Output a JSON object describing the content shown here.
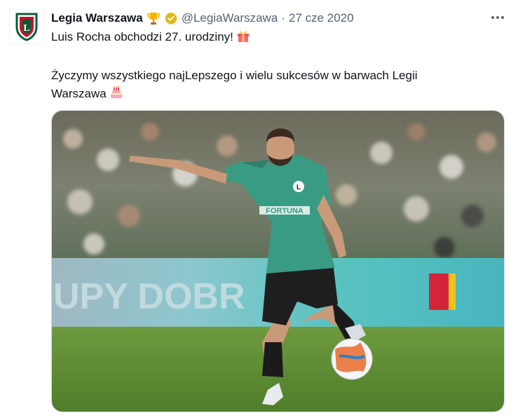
{
  "tweet": {
    "author_name": "Legia Warszawa",
    "handle": "@LegiaWarszawa",
    "separator": "·",
    "date": "27 cze 2020",
    "lines": [
      "Luis Rocha obchodzi 27. urodziny!",
      "Życzymy wszystkiego najLepszego i wielu sukcesów w barwach Legii",
      "Warszawa"
    ],
    "badge_icons": [
      "trophy-icon",
      "verified-badge-icon"
    ],
    "emojis": [
      "gift-emoji",
      "birthday-cake-emoji"
    ]
  },
  "media": {
    "description_icon": "football-player-photo",
    "shirt_sponsor": "FORTUNA",
    "board_text": "UPY DOBR"
  },
  "colors": {
    "text": "#0f1419",
    "secondary": "#536471",
    "verified_gold": "#e2b719",
    "border": "#cfd9de"
  }
}
